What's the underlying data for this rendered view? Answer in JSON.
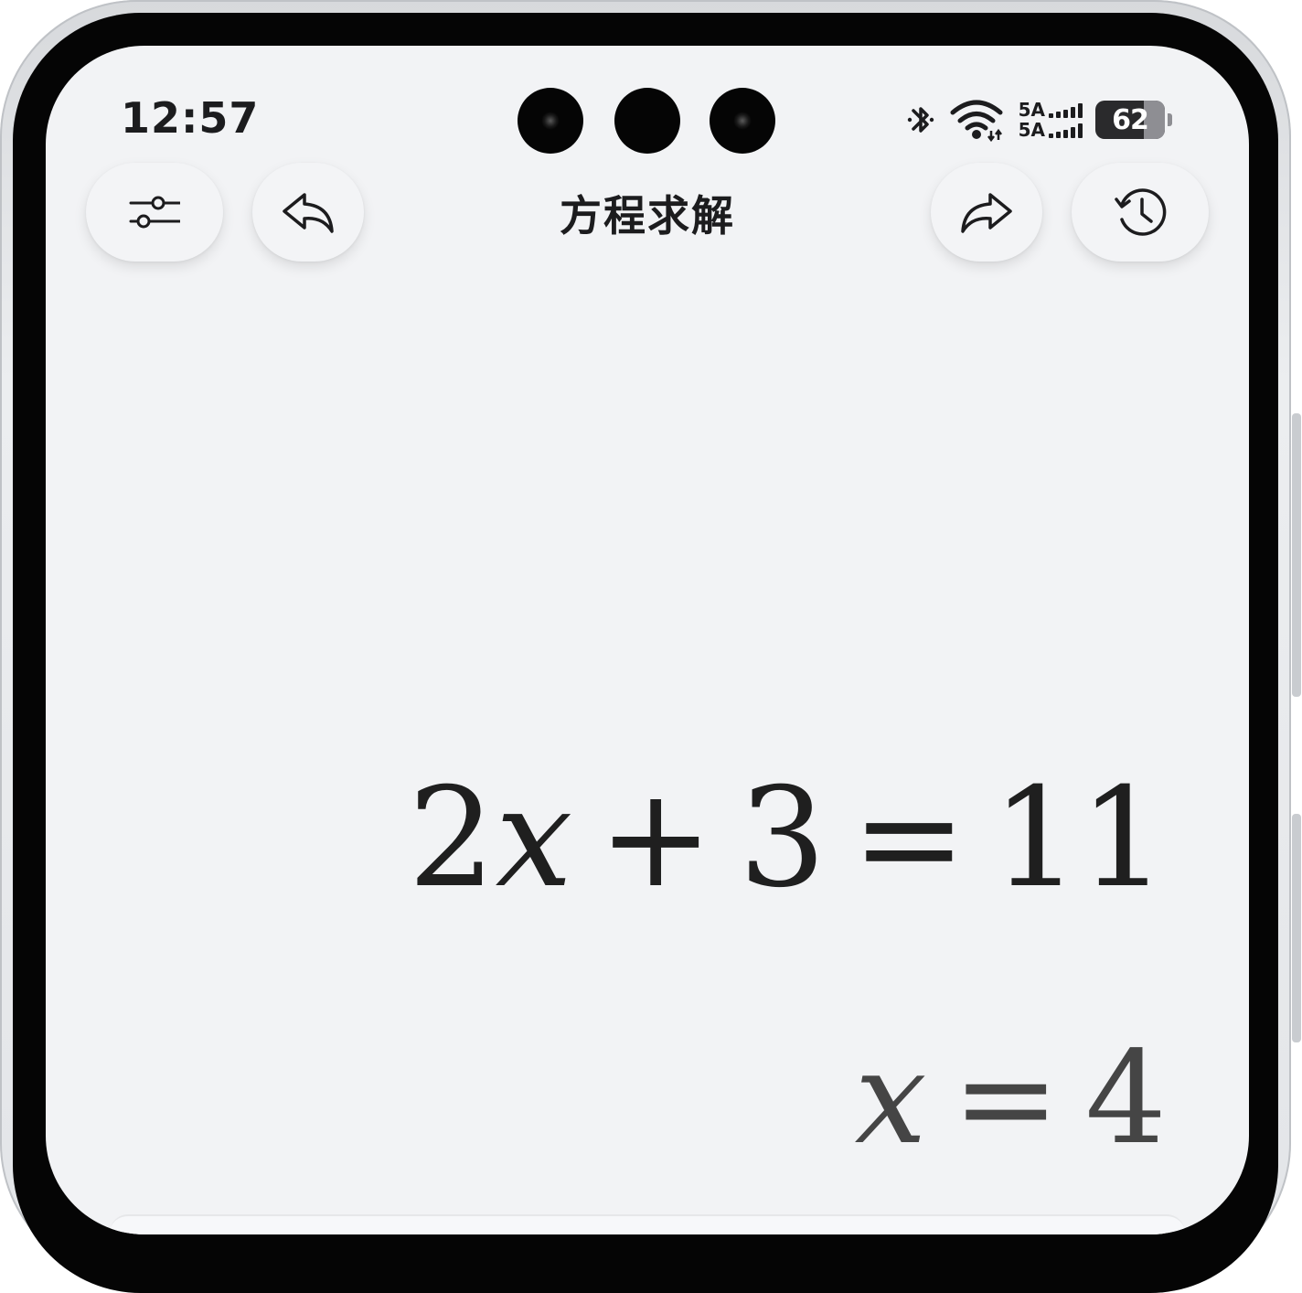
{
  "status_bar": {
    "time": "12:57",
    "network_top": "5A",
    "network_bottom": "5A",
    "battery_percent": "62",
    "icons": [
      "bluetooth-icon",
      "wifi-icon",
      "signal-icon",
      "battery-icon"
    ]
  },
  "header": {
    "title": "方程求解",
    "buttons": [
      "settings-sliders-icon",
      "undo-icon",
      "redo-icon",
      "history-icon"
    ]
  },
  "main": {
    "equation": {
      "coefficient": "2",
      "variable": "x",
      "plus": "+",
      "constant": "3",
      "equals": "=",
      "rhs": "11"
    },
    "solution": {
      "variable": "x",
      "equals": "=",
      "value": "4"
    }
  },
  "colors": {
    "screen_background": "#f2f3f5",
    "button_background": "#f3f4f6",
    "text_primary": "#1c1c1e",
    "solution_text": "#454545"
  }
}
